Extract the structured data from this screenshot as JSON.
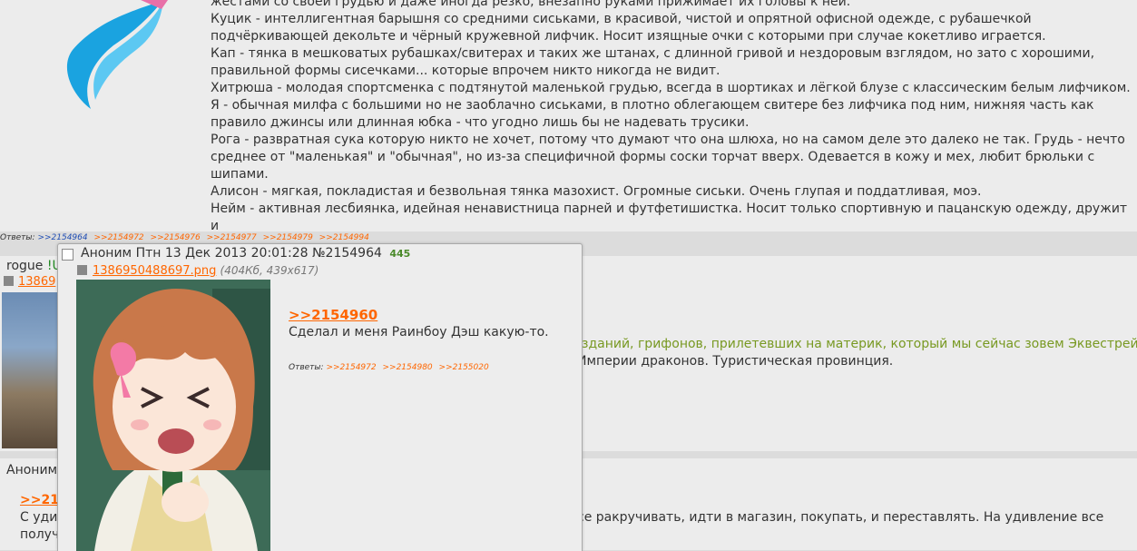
{
  "post1": {
    "lines": [
      "жестами со своей грудью и даже иногда резко, внезапно руками прижимает их головы к ней.",
      "Куцик - интеллигентная барышня со средними сиськами, в красивой, чистой и опрятной офисной одежде, с рубашечкой",
      "подчёркивающей декольте и чёрный кружевной лифчик. Носит изящные очки с которыми при случае кокетливо играется.",
      "Кап - тянка в мешковатых рубашках/свитерах и таких же штанах, с длинной гривой и нездоровым взглядом, но зато с хорошими,",
      "правильной формы сисечками... которые впрочем никто никогда не видит.",
      "Хитрюша - молодая спортсменка с подтянутой маленькой грудью, всегда в шортиках и лёгкой блузе с классическим белым лифчиком.",
      "Я - обычная милфа с большими но не заоблачно сиськами, в плотно облегающем свитере без лифчика под ним, нижняя часть как",
      "правило джинсы или длинная юбка - что угодно лишь бы не надевать трусики.",
      "Рога - развратная сука которую никто не хочет, потому что думают что она шлюха, но на самом деле это далеко не так. Грудь - нечто",
      "среднее от \"маленькая\" и \"обычная\", но из-за специфичной формы соски торчат вверх. Одевается в кожу и мех, любит брюльки с",
      "шипами.",
      "Алисон - мягкая, покладистая и безвольная тянка мазохист. Огромные сиськи. Очень глупая и поддатливая, моэ.",
      "Нейм - активная лесбиянка, идейная ненавистница парней и футфетишистка. Носит только спортивную и пацанскую одежду, дружит и"
    ],
    "replies_label": "Ответы:",
    "replies": [
      ">>2154964",
      ">>2154972",
      ">>2154976",
      ">>2154977",
      ">>2154979",
      ">>2154994"
    ]
  },
  "post2": {
    "name": "rogue",
    "trip": "!U",
    "file_partial": "13869",
    "text_line1": "зданий, грифонов, прилетевших на материк, который мы сейчас зовем Эквестрей",
    "text_line2": "Империи драконов. Туристическая провинция."
  },
  "post3": {
    "name": "Аноним",
    "ref_partial": ">>21",
    "line1_partial": "С уди",
    "line2_partial": "получ",
    "line1_right": "се ракручивать, идти в магазин, покупать, и переставлять. На удивление все"
  },
  "popup": {
    "name": "Аноним",
    "date": "Птн 13 Дек 2013 20:01:28",
    "post_number": "№2154964",
    "count": "445",
    "file_name": "1386950488697.png",
    "file_meta": "(404Кб, 439x617)",
    "reply_ref": ">>2154960",
    "text": "Сделал и меня Раинбоу Дэш какую-то.",
    "replies_label": "Ответы:",
    "replies": [
      ">>2154972",
      ">>2154980",
      ">>2155020"
    ]
  },
  "colors": {
    "link": "#ff6600",
    "greentext": "#789922",
    "background": "#dcdcdc",
    "post_bg": "#ececec"
  }
}
